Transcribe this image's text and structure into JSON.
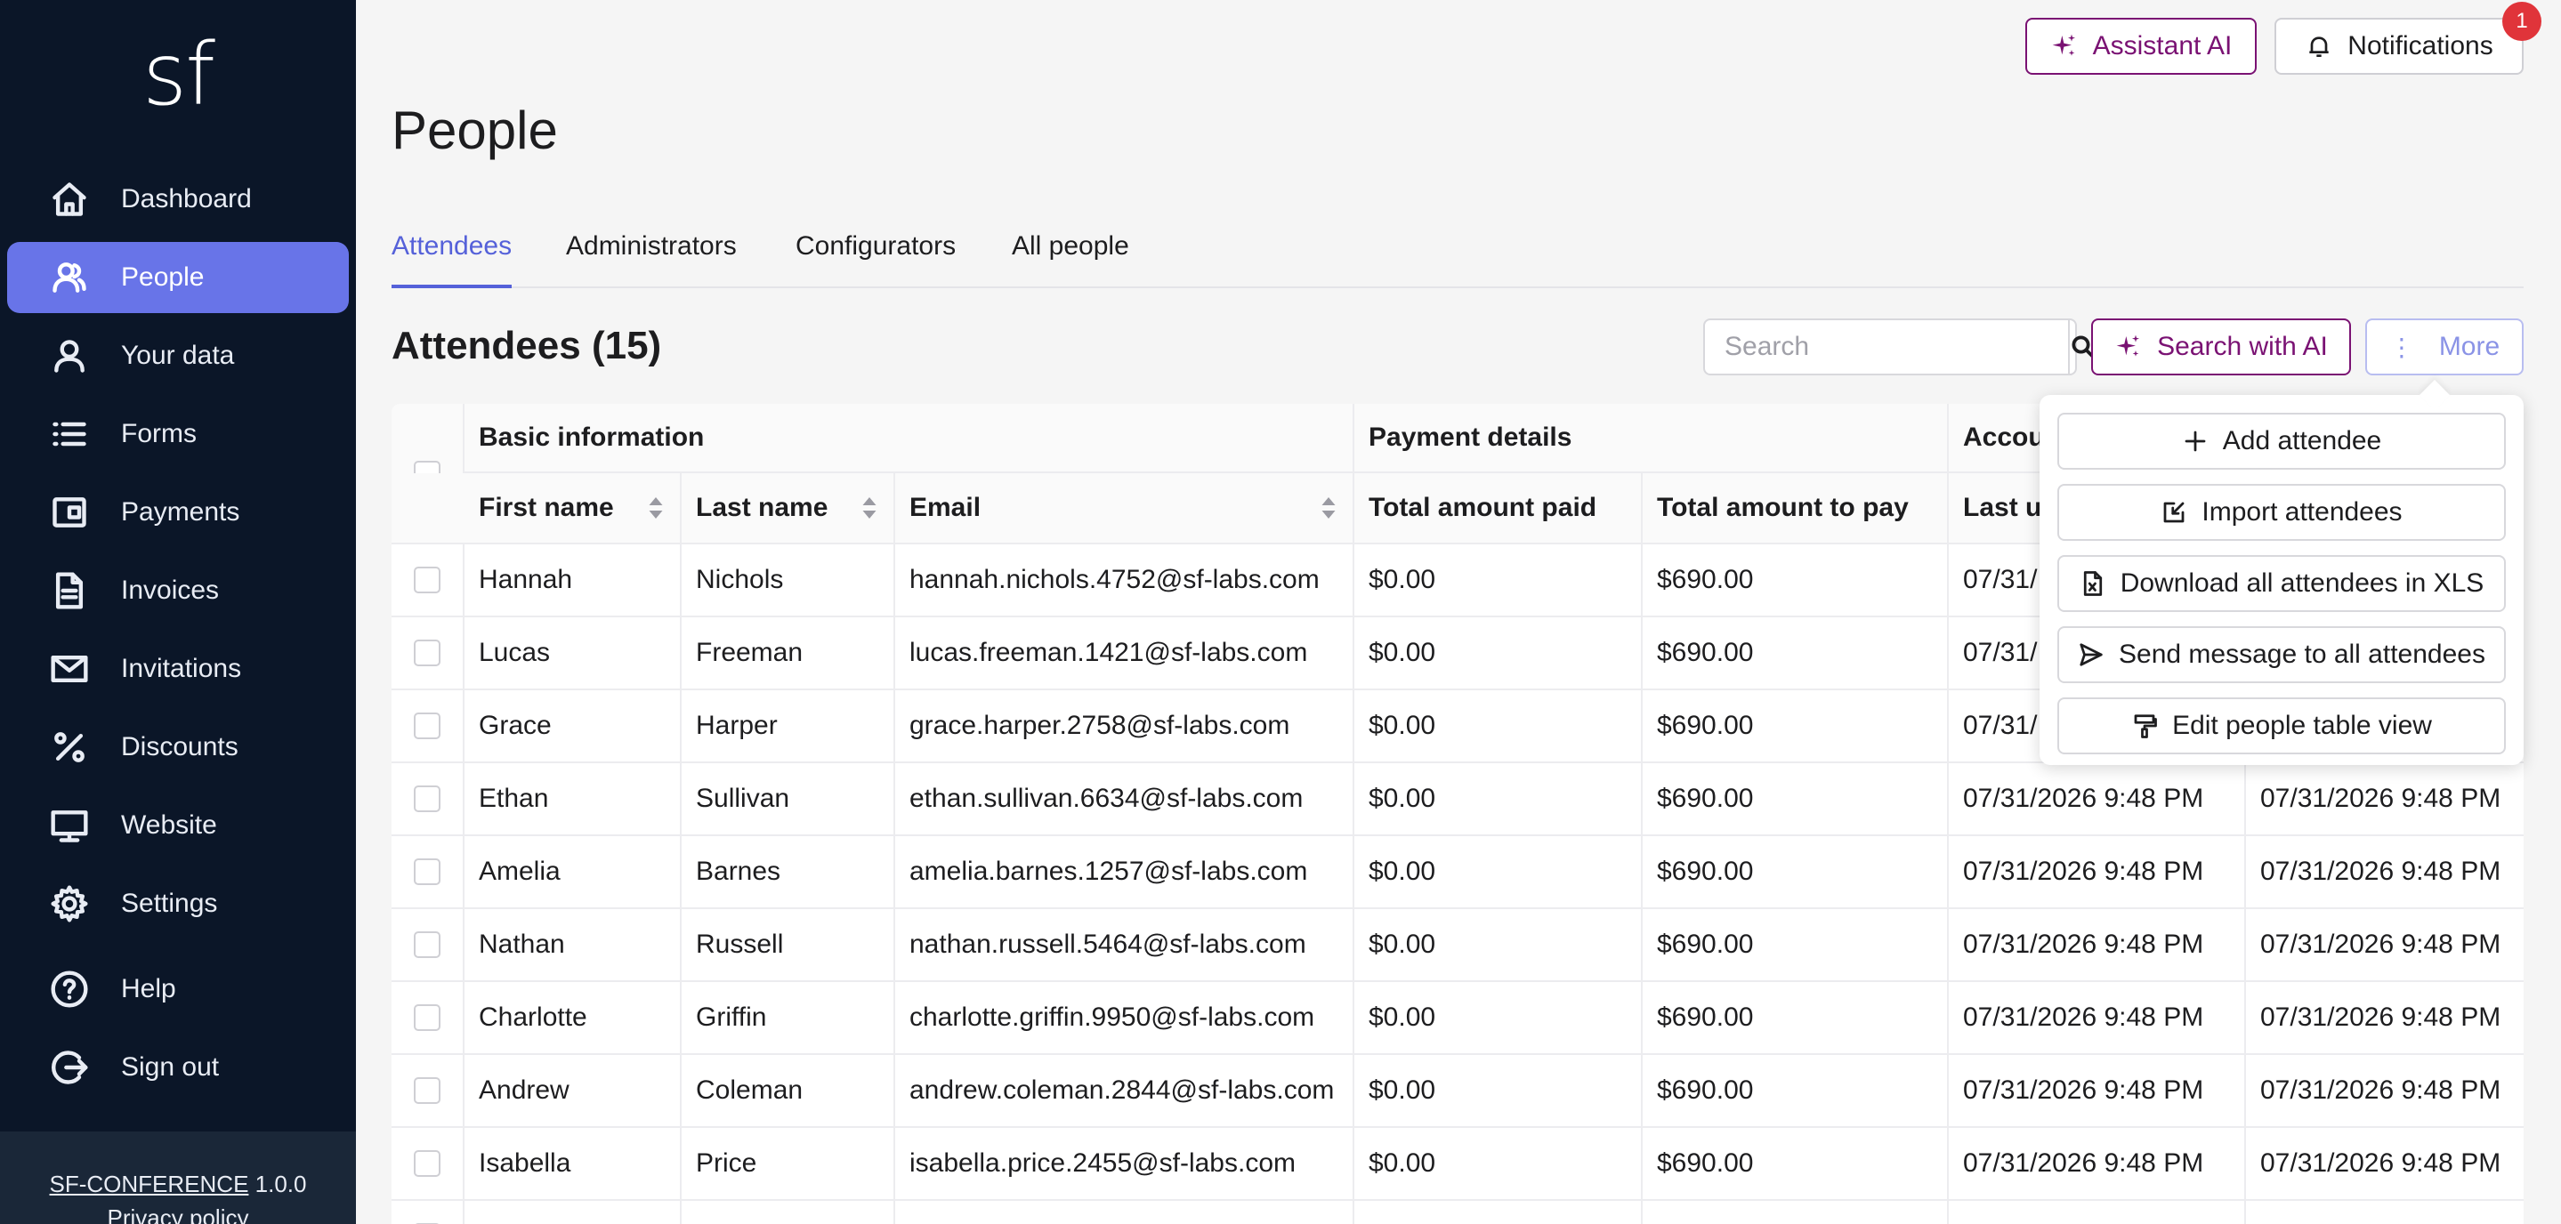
{
  "app": {
    "logo": "sf",
    "version_name": "SF-CONFERENCE",
    "version": "1.0.0",
    "privacy_link": "Privacy policy"
  },
  "sidebar": {
    "items": [
      {
        "label": "Dashboard",
        "icon": "home-icon"
      },
      {
        "label": "People",
        "icon": "people-icon",
        "active": true
      },
      {
        "label": "Your data",
        "icon": "user-icon"
      },
      {
        "label": "Forms",
        "icon": "list-icon"
      },
      {
        "label": "Payments",
        "icon": "wallet-icon"
      },
      {
        "label": "Invoices",
        "icon": "document-icon"
      },
      {
        "label": "Invitations",
        "icon": "mail-icon"
      },
      {
        "label": "Discounts",
        "icon": "percent-icon"
      },
      {
        "label": "Website",
        "icon": "monitor-icon"
      },
      {
        "label": "Settings",
        "icon": "gear-icon"
      },
      {
        "label": "Help",
        "icon": "help-icon"
      },
      {
        "label": "Sign out",
        "icon": "sign-out-icon"
      }
    ]
  },
  "topbar": {
    "assistant_label": "Assistant AI",
    "notifications_label": "Notifications",
    "notifications_count": "1"
  },
  "page": {
    "title": "People",
    "tabs": [
      "Attendees",
      "Administrators",
      "Configurators",
      "All people"
    ],
    "active_tab": "Attendees",
    "section_title": "Attendees (15)"
  },
  "toolbar": {
    "search_placeholder": "Search",
    "search_value": "",
    "search_ai_label": "Search with AI",
    "more_label": "More"
  },
  "more_menu": {
    "items": [
      {
        "label": "Add attendee",
        "icon": "plus-icon"
      },
      {
        "label": "Import attendees",
        "icon": "import-icon"
      },
      {
        "label": "Download all attendees in XLS",
        "icon": "file-xls-icon"
      },
      {
        "label": "Send message to all attendees",
        "icon": "send-icon"
      },
      {
        "label": "Edit people table view",
        "icon": "paint-roller-icon"
      }
    ]
  },
  "table": {
    "groups": {
      "basic": "Basic information",
      "payment": "Payment details",
      "account": "Accou"
    },
    "columns": {
      "first_name": "First name",
      "last_name": "Last name",
      "email": "Email",
      "paid": "Total amount paid",
      "to_pay": "Total amount to pay",
      "last_u": "Last u"
    },
    "rows": [
      {
        "first": "Hannah",
        "last": "Nichols",
        "email": "hannah.nichols.4752@sf-labs.com",
        "paid": "$0.00",
        "to_pay": "$690.00",
        "date1": "07/31/",
        "date2": ""
      },
      {
        "first": "Lucas",
        "last": "Freeman",
        "email": "lucas.freeman.1421@sf-labs.com",
        "paid": "$0.00",
        "to_pay": "$690.00",
        "date1": "07/31/",
        "date2": ""
      },
      {
        "first": "Grace",
        "last": "Harper",
        "email": "grace.harper.2758@sf-labs.com",
        "paid": "$0.00",
        "to_pay": "$690.00",
        "date1": "07/31/",
        "date2": ""
      },
      {
        "first": "Ethan",
        "last": "Sullivan",
        "email": "ethan.sullivan.6634@sf-labs.com",
        "paid": "$0.00",
        "to_pay": "$690.00",
        "date1": "07/31/2026 9:48 PM",
        "date2": "07/31/2026 9:48 PM"
      },
      {
        "first": "Amelia",
        "last": "Barnes",
        "email": "amelia.barnes.1257@sf-labs.com",
        "paid": "$0.00",
        "to_pay": "$690.00",
        "date1": "07/31/2026 9:48 PM",
        "date2": "07/31/2026 9:48 PM"
      },
      {
        "first": "Nathan",
        "last": "Russell",
        "email": "nathan.russell.5464@sf-labs.com",
        "paid": "$0.00",
        "to_pay": "$690.00",
        "date1": "07/31/2026 9:48 PM",
        "date2": "07/31/2026 9:48 PM"
      },
      {
        "first": "Charlotte",
        "last": "Griffin",
        "email": "charlotte.griffin.9950@sf-labs.com",
        "paid": "$0.00",
        "to_pay": "$690.00",
        "date1": "07/31/2026 9:48 PM",
        "date2": "07/31/2026 9:48 PM"
      },
      {
        "first": "Andrew",
        "last": "Coleman",
        "email": "andrew.coleman.2844@sf-labs.com",
        "paid": "$0.00",
        "to_pay": "$690.00",
        "date1": "07/31/2026 9:48 PM",
        "date2": "07/31/2026 9:48 PM"
      },
      {
        "first": "Isabella",
        "last": "Price",
        "email": "isabella.price.2455@sf-labs.com",
        "paid": "$0.00",
        "to_pay": "$690.00",
        "date1": "07/31/2026 9:48 PM",
        "date2": "07/31/2026 9:48 PM"
      },
      {
        "first": "",
        "last": "",
        "email": "",
        "paid": "",
        "to_pay": "",
        "date1": "",
        "date2": ""
      }
    ]
  },
  "colors": {
    "sidebar_bg": "#0b1628",
    "active_nav": "#6874e8",
    "accent": "#5561d9",
    "ai_purple": "#7a1273",
    "badge_red": "#e0343a"
  }
}
